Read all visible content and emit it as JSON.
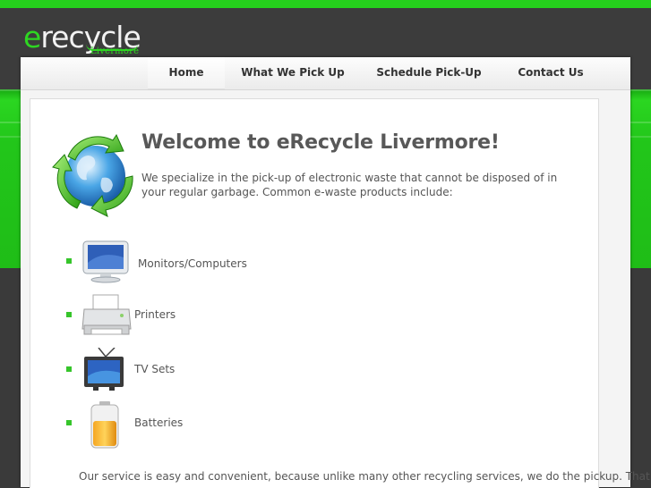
{
  "brand": {
    "logo_main": "recycle",
    "logo_e": "e",
    "logo_sub": "Livermore"
  },
  "nav": {
    "items": [
      {
        "label": "Home",
        "active": true
      },
      {
        "label": "What We Pick Up",
        "active": false
      },
      {
        "label": "Schedule Pick-Up",
        "active": false
      },
      {
        "label": "Contact Us",
        "active": false
      }
    ]
  },
  "main": {
    "title": "Welcome to eRecycle Livermore!",
    "intro": "We specialize in the pick-up of electronic waste that cannot be disposed of in your regular garbage. Common e-waste products include:",
    "products": [
      {
        "label": "Monitors/Computers",
        "icon": "monitor-icon"
      },
      {
        "label": "Printers",
        "icon": "printer-icon"
      },
      {
        "label": "TV Sets",
        "icon": "tv-icon"
      },
      {
        "label": "Batteries",
        "icon": "battery-icon"
      }
    ],
    "footer": "Our service is easy and convenient, because unlike many other recycling services, we do the pickup. That"
  },
  "colors": {
    "accent_green": "#22c61a",
    "dark_bg": "#3a3a3a",
    "text": "#555555"
  }
}
